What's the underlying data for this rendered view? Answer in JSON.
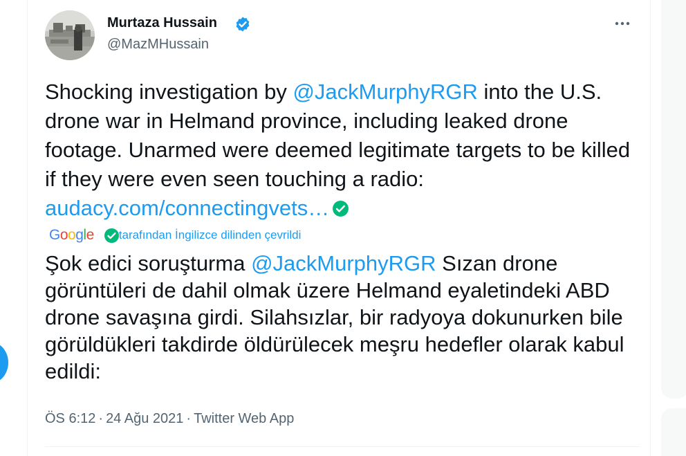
{
  "tweet": {
    "author": {
      "display_name": "Murtaza Hussain",
      "handle": "@MazMHussain",
      "verified": true
    },
    "text_segments": {
      "part1": "Shocking investigation by ",
      "mention": "@JackMurphyRGR",
      "part2": " into the U.S. drone war in Helmand province, including leaked drone footage. Unarmed were deemed legitimate targets to be killed if they were even seen touching a radio: ",
      "link": "audacy.com/connectingvets…"
    },
    "translation": {
      "provider": "Google",
      "attribution": "tarafından İngilizce dilinden çevrildi",
      "part1": "Şok edici soruşturma ",
      "mention": "@JackMurphyRGR",
      "part2": " Sızan drone görüntüleri de dahil olmak üzere Helmand eyaletindeki ABD drone savaşına girdi. Silahsızlar, bir radyoya dokunurken bile görüldükleri takdirde öldürülecek meşru hedefler olarak kabul edildi:"
    },
    "meta": {
      "time": "ÖS 6:12",
      "separator": "·",
      "date": "24 Ağu 2021",
      "source": "Twitter Web App"
    }
  },
  "icons": {
    "more": "more-horizontal-icon",
    "verified": "verified-badge-icon",
    "link_check": "check-circle-icon",
    "translate_check": "check-circle-icon"
  },
  "colors": {
    "link": "#1d9bf0",
    "text": "#0f1419",
    "secondary": "#536471",
    "check_green": "#00ba7c"
  }
}
